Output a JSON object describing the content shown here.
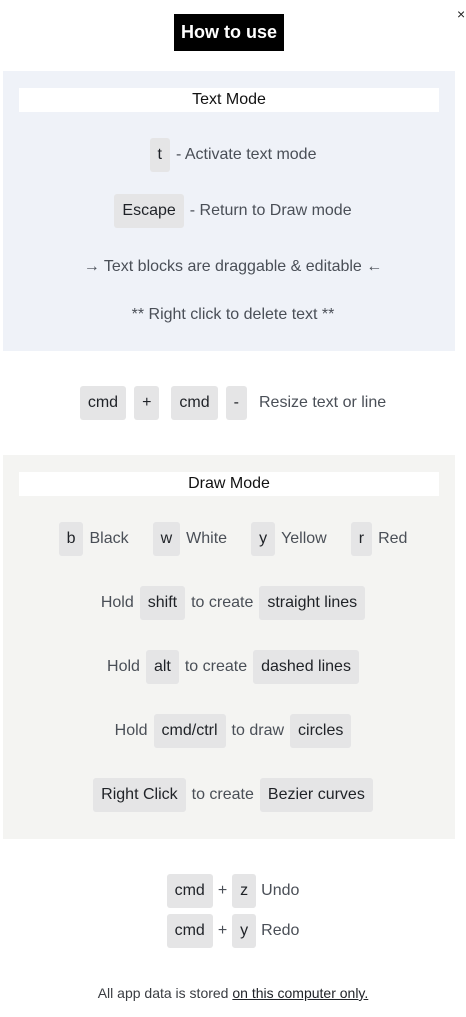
{
  "header": {
    "title": "How to use",
    "close_label": "×"
  },
  "text_mode": {
    "heading": "Text Mode",
    "activate_key": "t",
    "activate_desc": "- Activate text mode",
    "escape_key": "Escape",
    "escape_desc": "- Return to Draw mode",
    "drag_note": "→ Text blocks are draggable & editable ←",
    "delete_note": "** Right click to delete text **"
  },
  "resize": {
    "key1": "cmd",
    "plus": "+",
    "key2": "cmd",
    "minus": "-",
    "desc": "Resize text or line"
  },
  "draw_mode": {
    "heading": "Draw Mode",
    "colors": [
      {
        "key": "b",
        "label": "Black"
      },
      {
        "key": "w",
        "label": "White"
      },
      {
        "key": "y",
        "label": "Yellow"
      },
      {
        "key": "r",
        "label": "Red"
      }
    ],
    "shift_row": {
      "hold": "Hold",
      "key": "shift",
      "mid": "to create",
      "result": "straight lines"
    },
    "alt_row": {
      "hold": "Hold",
      "key": "alt",
      "mid": "to create",
      "result": "dashed lines"
    },
    "cmd_row": {
      "hold": "Hold",
      "key": "cmd/ctrl",
      "mid": "to draw",
      "result": "circles"
    },
    "right_row": {
      "key": "Right Click",
      "mid": "to create",
      "result": "Bezier curves"
    }
  },
  "shortcuts": {
    "undo": {
      "mod": "cmd",
      "plus": "+",
      "key": "z",
      "label": "Undo"
    },
    "redo": {
      "mod": "cmd",
      "plus": "+",
      "key": "y",
      "label": "Redo"
    }
  },
  "footer": {
    "text": "All app data is stored ",
    "link": "on this computer only."
  }
}
